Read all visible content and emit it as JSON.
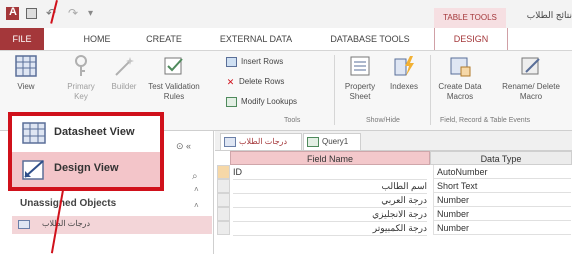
{
  "title_bar": {
    "contextual_tab_group": "TABLE TOOLS",
    "document_title": "نتائج الطلاب"
  },
  "ribbon_tabs": [
    "FILE",
    "HOME",
    "CREATE",
    "EXTERNAL DATA",
    "DATABASE TOOLS",
    "DESIGN"
  ],
  "ribbon": {
    "view_label": "View",
    "primary_key_label": "Primary Key",
    "builder_label": "Builder",
    "test_validation_label": "Test Validation Rules",
    "insert_rows_label": "Insert Rows",
    "delete_rows_label": "Delete Rows",
    "modify_lookups_label": "Modify Lookups",
    "tools_group_label": "Tools",
    "property_sheet_label": "Property Sheet",
    "indexes_label": "Indexes",
    "show_hide_group_label": "Show/Hide",
    "create_data_macros_label": "Create Data Macros",
    "rename_delete_macro_label": "Rename/ Delete Macro",
    "field_record_group_label": "Field, Record & Table Events"
  },
  "view_menu": {
    "datasheet_view_label": "Datasheet View",
    "design_view_label": "Design View"
  },
  "nav_pane": {
    "unassigned_label": "Unassigned Objects",
    "table_item_label": "درجات الطلاب"
  },
  "doc_tabs": [
    {
      "label": "درجات الطلاب"
    },
    {
      "label": "Query1"
    }
  ],
  "design_grid": {
    "headers": {
      "field_name": "Field Name",
      "data_type": "Data Type"
    },
    "rows": [
      {
        "field_name": "ID",
        "data_type": "AutoNumber"
      },
      {
        "field_name": "اسم الطالب",
        "data_type": "Short Text"
      },
      {
        "field_name": "درجة العربي",
        "data_type": "Number"
      },
      {
        "field_name": "درجة الانجليزي",
        "data_type": "Number"
      },
      {
        "field_name": "درجة الكمبيوتر",
        "data_type": "Number"
      }
    ]
  },
  "colors": {
    "accent": "#a4373a",
    "highlight_border": "#d0111b",
    "selection_fill": "#f3c5c9"
  }
}
